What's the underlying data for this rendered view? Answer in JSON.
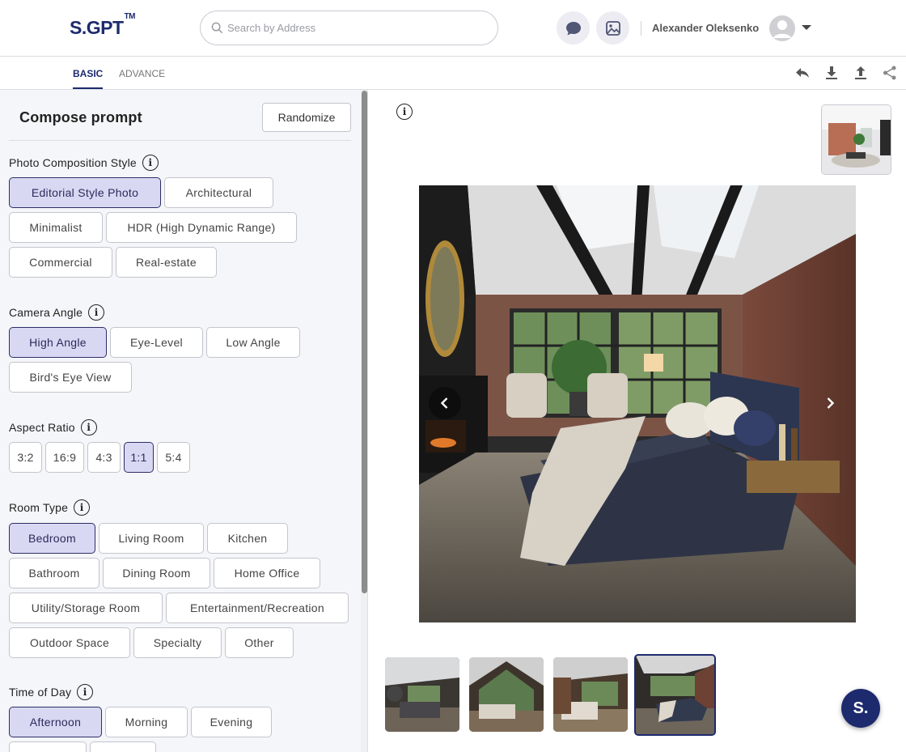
{
  "header": {
    "logo": "S.GPT",
    "logo_tm": "TM",
    "search_placeholder": "Search by Address",
    "username": "Alexander Oleksenko"
  },
  "tabs": [
    {
      "label": "BASIC",
      "active": true
    },
    {
      "label": "ADVANCE",
      "active": false
    }
  ],
  "compose": {
    "title": "Compose prompt",
    "randomize_label": "Randomize"
  },
  "sections": {
    "photo_style": {
      "label": "Photo Composition Style",
      "options": [
        "Editorial Style Photo",
        "Architectural",
        "Minimalist",
        "HDR (High Dynamic Range)",
        "Commercial",
        "Real-estate"
      ],
      "selected": "Editorial Style Photo"
    },
    "camera_angle": {
      "label": "Camera Angle",
      "options": [
        "High Angle",
        "Eye-Level",
        "Low Angle",
        "Bird's Eye View"
      ],
      "selected": "High Angle"
    },
    "aspect_ratio": {
      "label": "Aspect Ratio",
      "options": [
        "3:2",
        "16:9",
        "4:3",
        "1:1",
        "5:4"
      ],
      "selected": "1:1"
    },
    "room_type": {
      "label": "Room Type",
      "options": [
        "Bedroom",
        "Living Room",
        "Kitchen",
        "Bathroom",
        "Dining Room",
        "Home Office",
        "Utility/Storage Room",
        "Entertainment/Recreation",
        "Outdoor Space",
        "Specialty",
        "Other"
      ],
      "selected": "Bedroom"
    },
    "time_of_day": {
      "label": "Time of Day",
      "options": [
        "Afternoon",
        "Morning",
        "Evening"
      ],
      "selected": "Afternoon"
    }
  },
  "fab_label": "S.",
  "colors": {
    "brand": "#1d2a6e",
    "selected_chip_bg": "#d9d8f3",
    "panel_bg": "#f5f6f9"
  }
}
